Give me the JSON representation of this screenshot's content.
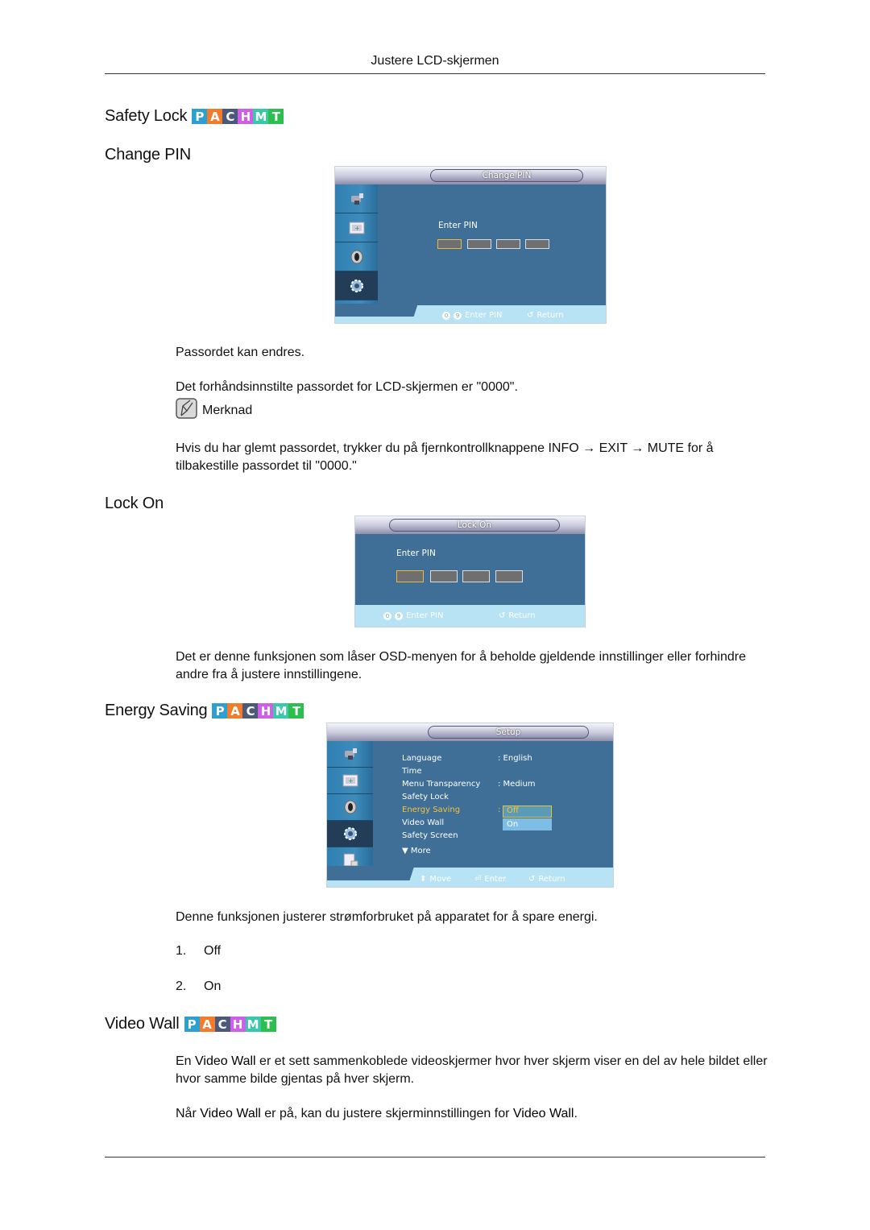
{
  "page": {
    "header_title": "Justere LCD-skjermen",
    "badge_letters": [
      {
        "letter": "P",
        "color": "#2e9fd3"
      },
      {
        "letter": "A",
        "color": "#f27c2c"
      },
      {
        "letter": "C",
        "color": "#4b5a7a"
      },
      {
        "letter": "H",
        "color": "#cf5ee8"
      },
      {
        "letter": "M",
        "color": "#39c8a8"
      },
      {
        "letter": "T",
        "color": "#2cbf4e"
      }
    ]
  },
  "sections": {
    "safety_lock": {
      "title": "Safety Lock"
    },
    "change_pin": {
      "title": "Change PIN",
      "osd": {
        "title": "Change PIN",
        "prompt": "Enter PIN",
        "footer_keys": "0..9",
        "footer_key_from": "0",
        "footer_key_to": "9",
        "footer_action": "Enter PIN",
        "footer_return": "Return",
        "sidebar_icons": [
          "input-icon",
          "picture-icon",
          "sound-icon",
          "setup-icon",
          "multi-control-icon"
        ],
        "active_sidebar_index": 3
      },
      "paragraphs": [
        "Passordet kan endres.",
        "Det forhåndsinnstilte passordet for LCD-skjermen er \"0000\"."
      ],
      "note": {
        "label": "Merknad",
        "text": "Hvis du har glemt passordet, trykker du på fjernkontrollknappene INFO → EXIT → MUTE for å tilbakestille passordet til \"0000.\""
      }
    },
    "lock_on": {
      "title": "Lock On",
      "osd": {
        "title": "Lock On",
        "prompt": "Enter PIN",
        "footer_key_from": "0",
        "footer_key_to": "9",
        "footer_action": "Enter PIN",
        "footer_return": "Return"
      },
      "paragraph": "Det er denne funksjonen som låser OSD-menyen for å beholde gjeldende innstillinger eller forhindre andre fra å justere innstillingene."
    },
    "energy_saving": {
      "title": "Energy Saving",
      "osd": {
        "title": "Setup",
        "menu": [
          {
            "label": "Language",
            "value": ": English"
          },
          {
            "label": "Time",
            "value": ""
          },
          {
            "label": "Menu Transparency",
            "value": ": Medium"
          },
          {
            "label": "Safety Lock",
            "value": ""
          },
          {
            "label": "Energy Saving",
            "value": ":",
            "highlighted": true
          },
          {
            "label": "Video Wall",
            "value": ""
          },
          {
            "label": "Safety Screen",
            "value": ""
          },
          {
            "label": "▼ More",
            "value": ""
          }
        ],
        "dropdown_options": [
          "Off",
          "On"
        ],
        "dropdown_selected": "Off",
        "footer_move": "Move",
        "footer_enter": "Enter",
        "footer_return": "Return",
        "highlight_color": "#f3c23c"
      },
      "paragraph": "Denne funksjonen justerer strømforbruket på apparatet for å spare energi.",
      "options": [
        {
          "num": "1.",
          "label": "Off"
        },
        {
          "num": "2.",
          "label": "On"
        }
      ]
    },
    "video_wall": {
      "title": "Video Wall",
      "p1_pre": "En ",
      "p1_term": "Video Wall",
      "p1_post": " er et sett sammenkoblede videoskjermer hvor hver skjerm viser en del av hele bildet eller hvor samme bilde gjentas på hver skjerm.",
      "p2_pre": "Når ",
      "p2_term1": "Video Wall",
      "p2_mid": " er på, kan du justere skjerminnstillingen for ",
      "p2_term2": "Video Wall",
      "p2_post": "."
    }
  }
}
